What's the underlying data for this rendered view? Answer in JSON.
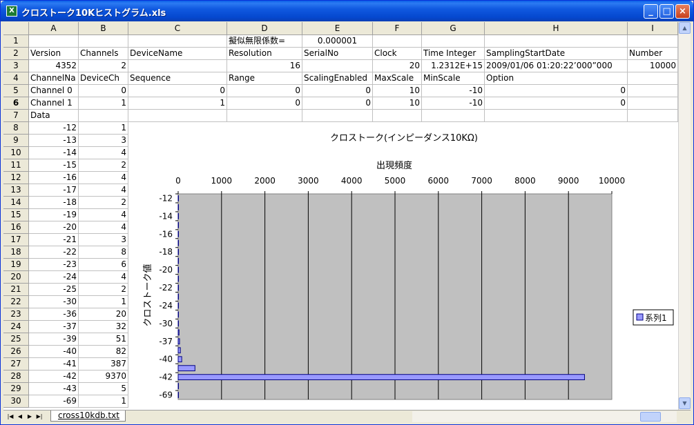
{
  "window": {
    "title": "クロストーク10Kヒストグラム.xls"
  },
  "columns": [
    "A",
    "B",
    "C",
    "D",
    "E",
    "F",
    "G",
    "H",
    "I"
  ],
  "rows": {
    "r1": {
      "D": "擬似無限係数=",
      "E": "0.000001"
    },
    "r2": {
      "A": "Version",
      "B": "Channels",
      "C": "DeviceName",
      "D": "Resolution",
      "E": "SerialNo",
      "F": "Clock",
      "G": "Time Integer",
      "H": "SamplingStartDate",
      "I": "Number"
    },
    "r3": {
      "A": "4352",
      "B": "2",
      "D": "16",
      "F": "20",
      "G": "1.2312E+15",
      "H": "2009/01/06 01:20:22’000”000",
      "I": "10000"
    },
    "r4": {
      "A": "ChannelNa",
      "B": "DeviceCh",
      "C": "Sequence",
      "D": "Range",
      "E": "ScalingEnabled",
      "F": "MaxScale",
      "G": "MinScale",
      "H": "Option"
    },
    "r5": {
      "A": "Channel 0",
      "B": "0",
      "C": "0",
      "D": "0",
      "E": "0",
      "F": "10",
      "G": "-10",
      "H": "0"
    },
    "r6": {
      "A": "Channel 1",
      "B": "1",
      "C": "1",
      "D": "0",
      "E": "0",
      "F": "10",
      "G": "-10",
      "H": "0"
    },
    "r7": {
      "A": "Data"
    }
  },
  "data_rows": [
    [
      "-12",
      "1"
    ],
    [
      "-13",
      "3"
    ],
    [
      "-14",
      "4"
    ],
    [
      "-15",
      "2"
    ],
    [
      "-16",
      "4"
    ],
    [
      "-17",
      "4"
    ],
    [
      "-18",
      "2"
    ],
    [
      "-19",
      "4"
    ],
    [
      "-20",
      "4"
    ],
    [
      "-21",
      "3"
    ],
    [
      "-22",
      "8"
    ],
    [
      "-23",
      "6"
    ],
    [
      "-24",
      "4"
    ],
    [
      "-25",
      "2"
    ],
    [
      "-30",
      "1"
    ],
    [
      "-36",
      "20"
    ],
    [
      "-37",
      "32"
    ],
    [
      "-39",
      "51"
    ],
    [
      "-40",
      "82"
    ],
    [
      "-41",
      "387"
    ],
    [
      "-42",
      "9370"
    ],
    [
      "-43",
      "5"
    ],
    [
      "-69",
      "1"
    ]
  ],
  "row_numbers": [
    "1",
    "2",
    "3",
    "4",
    "5",
    "6",
    "7",
    "8",
    "9",
    "10",
    "11",
    "12",
    "13",
    "14",
    "15",
    "16",
    "17",
    "18",
    "19",
    "20",
    "21",
    "22",
    "23",
    "24",
    "25",
    "26",
    "27",
    "28",
    "29",
    "30"
  ],
  "selected_row": "6",
  "chart_data": {
    "type": "bar",
    "orientation": "horizontal",
    "title": "クロストーク(インピーダンス10KΩ)",
    "xlabel": "出現頻度",
    "ylabel": "クロストーク値",
    "xlim": [
      0,
      10000
    ],
    "xticks": [
      "0",
      "1000",
      "2000",
      "3000",
      "4000",
      "5000",
      "6000",
      "7000",
      "8000",
      "9000",
      "10000"
    ],
    "categories": [
      "-12",
      "-13",
      "-14",
      "-15",
      "-16",
      "-17",
      "-18",
      "-19",
      "-20",
      "-21",
      "-22",
      "-23",
      "-24",
      "-25",
      "-30",
      "-36",
      "-37",
      "-39",
      "-40",
      "-41",
      "-42",
      "-43",
      "-69"
    ],
    "ytick_labels": [
      "-12",
      "-14",
      "-16",
      "-18",
      "-20",
      "-22",
      "-24",
      "-30",
      "-37",
      "-40",
      "-42",
      "-69"
    ],
    "series": [
      {
        "name": "系列1",
        "values": [
          1,
          3,
          4,
          2,
          4,
          4,
          2,
          4,
          4,
          3,
          8,
          6,
          4,
          2,
          1,
          20,
          32,
          51,
          82,
          387,
          9370,
          5,
          1
        ]
      }
    ],
    "plot_bg": "#c0c0c0",
    "bar_color": "#9999ff",
    "legend": "right"
  },
  "sheet_tabs": [
    "cross10kdb.txt"
  ]
}
